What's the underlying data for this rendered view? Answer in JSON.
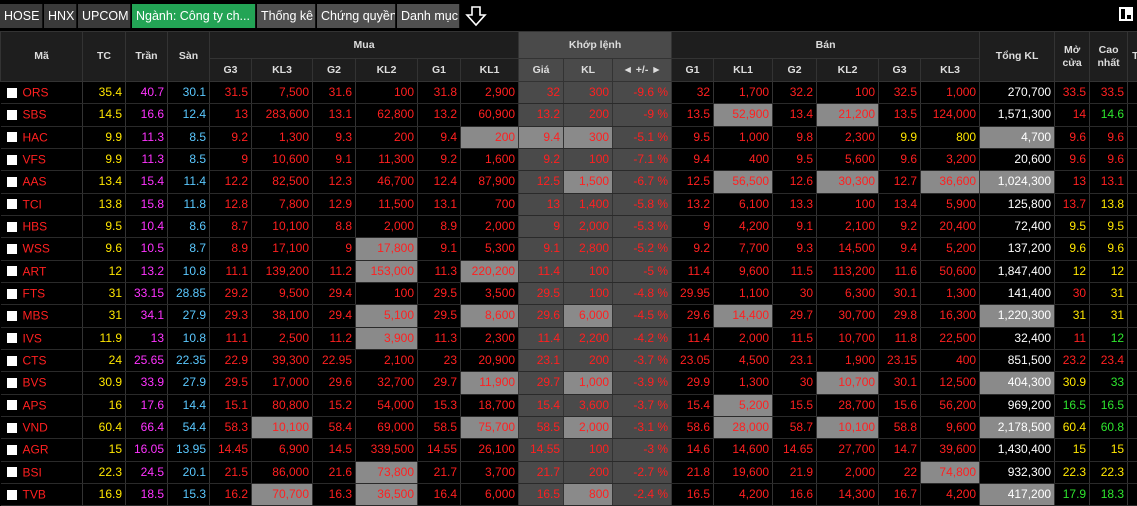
{
  "tabs": [
    {
      "label": "HOSE",
      "active": false
    },
    {
      "label": "HNX",
      "active": false
    },
    {
      "label": "UPCOM",
      "active": false
    },
    {
      "label": "Ngành: Công ty ch...",
      "active": true
    },
    {
      "label": "Thống kê",
      "active": false
    },
    {
      "label": "Chứng quyền",
      "active": false
    },
    {
      "label": "Danh mục",
      "active": false
    }
  ],
  "colors": {
    "up": "#ff2020",
    "ref": "#ffe600",
    "ceil": "#ff33ff",
    "floor": "#5ac8ff",
    "down": "#2ee52e",
    "active_tab": "#23a455"
  },
  "header": {
    "ma": "Mã",
    "tc": "TC",
    "tran": "Trần",
    "san": "Sàn",
    "mua": "Mua",
    "khop": "Khớp lệnh",
    "ban": "Bán",
    "tong_kl": "Tổng KL",
    "mo_cua": "Mở cửa",
    "cao_nhat": "Cao nhất",
    "thap_nhat": "Thấ",
    "mua_cols": [
      "G3",
      "KL3",
      "G2",
      "KL2",
      "G1",
      "KL1"
    ],
    "khop_cols": [
      "Giá",
      "KL",
      "◄ +/- ►"
    ],
    "ban_cols": [
      "G1",
      "KL1",
      "G2",
      "KL2",
      "G3",
      "KL3"
    ]
  },
  "rows": [
    {
      "cells": [
        "ORS",
        "35.4",
        "40.7",
        "30.1",
        "31.5",
        "7,500",
        "31.6",
        "100",
        "31.8",
        "2,900",
        "32",
        "300",
        "-9.6 %",
        "32",
        "1,700",
        "32.2",
        "100",
        "32.5",
        "1,000",
        "270,700",
        "33.5",
        "33.5",
        "33"
      ],
      "colors": [
        "r",
        "ref",
        "ceil",
        "floor",
        "r",
        "r",
        "r",
        "r",
        "r",
        "r",
        "r",
        "r",
        "r",
        "r",
        "r",
        "r",
        "r",
        "r",
        "r",
        "w",
        "r",
        "r",
        "r"
      ],
      "hl": []
    },
    {
      "cells": [
        "SBS",
        "14.5",
        "16.6",
        "12.4",
        "13",
        "283,600",
        "13.1",
        "62,800",
        "13.2",
        "60,900",
        "13.2",
        "200",
        "-9 %",
        "13.5",
        "52,900",
        "13.4",
        "21,200",
        "13.5",
        "124,000",
        "1,571,300",
        "14",
        "14.6",
        "13"
      ],
      "colors": [
        "r",
        "ref",
        "ceil",
        "floor",
        "r",
        "r",
        "r",
        "r",
        "r",
        "r",
        "r",
        "r",
        "r",
        "r",
        "r",
        "r",
        "r",
        "r",
        "r",
        "w",
        "r",
        "g",
        "r"
      ],
      "hl": [
        14,
        16
      ]
    },
    {
      "cells": [
        "HAC",
        "9.9",
        "11.3",
        "8.5",
        "9.2",
        "1,300",
        "9.3",
        "200",
        "9.4",
        "200",
        "9.4",
        "300",
        "-5.1 %",
        "9.5",
        "1,000",
        "9.8",
        "2,300",
        "9.9",
        "800",
        "4,700",
        "9.6",
        "9.6",
        "9"
      ],
      "colors": [
        "r",
        "ref",
        "ceil",
        "floor",
        "r",
        "r",
        "r",
        "r",
        "r",
        "r",
        "r",
        "r",
        "r",
        "r",
        "r",
        "r",
        "r",
        "y",
        "y",
        "w",
        "r",
        "r",
        "r"
      ],
      "hl": [
        9,
        10,
        11,
        19
      ]
    },
    {
      "cells": [
        "VFS",
        "9.9",
        "11.3",
        "8.5",
        "9",
        "10,600",
        "9.1",
        "11,300",
        "9.2",
        "1,600",
        "9.2",
        "100",
        "-7.1 %",
        "9.4",
        "400",
        "9.5",
        "5,600",
        "9.6",
        "3,200",
        "20,600",
        "9.6",
        "9.6",
        "9"
      ],
      "colors": [
        "r",
        "ref",
        "ceil",
        "floor",
        "r",
        "r",
        "r",
        "r",
        "r",
        "r",
        "r",
        "r",
        "r",
        "r",
        "r",
        "r",
        "r",
        "r",
        "r",
        "w",
        "r",
        "r",
        "r"
      ],
      "hl": []
    },
    {
      "cells": [
        "AAS",
        "13.4",
        "15.4",
        "11.4",
        "12.2",
        "82,500",
        "12.3",
        "46,700",
        "12.4",
        "87,900",
        "12.5",
        "1,500",
        "-6.7 %",
        "12.5",
        "56,500",
        "12.6",
        "30,300",
        "12.7",
        "36,600",
        "1,024,300",
        "13",
        "13.1",
        "12"
      ],
      "colors": [
        "r",
        "ref",
        "ceil",
        "floor",
        "r",
        "r",
        "r",
        "r",
        "r",
        "r",
        "r",
        "r",
        "r",
        "r",
        "r",
        "r",
        "r",
        "r",
        "r",
        "w",
        "r",
        "r",
        "r"
      ],
      "hl": [
        11,
        14,
        16,
        18,
        19
      ]
    },
    {
      "cells": [
        "TCI",
        "13.8",
        "15.8",
        "11.8",
        "12.8",
        "7,800",
        "12.9",
        "11,500",
        "13.1",
        "700",
        "13",
        "1,400",
        "-5.8 %",
        "13.2",
        "6,100",
        "13.3",
        "100",
        "13.4",
        "5,900",
        "125,800",
        "13.7",
        "13.8",
        "12"
      ],
      "colors": [
        "r",
        "ref",
        "ceil",
        "floor",
        "r",
        "r",
        "r",
        "r",
        "r",
        "r",
        "r",
        "r",
        "r",
        "r",
        "r",
        "r",
        "r",
        "r",
        "r",
        "w",
        "r",
        "y",
        "r"
      ],
      "hl": []
    },
    {
      "cells": [
        "HBS",
        "9.5",
        "10.4",
        "8.6",
        "8.7",
        "10,100",
        "8.8",
        "2,000",
        "8.9",
        "2,000",
        "9",
        "2,000",
        "-5.3 %",
        "9",
        "4,200",
        "9.1",
        "2,100",
        "9.2",
        "20,400",
        "72,400",
        "9.5",
        "9.5",
        "8"
      ],
      "colors": [
        "r",
        "ref",
        "ceil",
        "floor",
        "r",
        "r",
        "r",
        "r",
        "r",
        "r",
        "r",
        "r",
        "r",
        "r",
        "r",
        "r",
        "r",
        "r",
        "r",
        "w",
        "y",
        "y",
        "r"
      ],
      "hl": []
    },
    {
      "cells": [
        "WSS",
        "9.6",
        "10.5",
        "8.7",
        "8.9",
        "17,100",
        "9",
        "17,800",
        "9.1",
        "5,300",
        "9.1",
        "2,800",
        "-5.2 %",
        "9.2",
        "7,700",
        "9.3",
        "14,500",
        "9.4",
        "5,200",
        "137,200",
        "9.6",
        "9.6",
        "9"
      ],
      "colors": [
        "r",
        "ref",
        "ceil",
        "floor",
        "r",
        "r",
        "r",
        "r",
        "r",
        "r",
        "r",
        "r",
        "r",
        "r",
        "r",
        "r",
        "r",
        "r",
        "r",
        "w",
        "y",
        "y",
        "r"
      ],
      "hl": [
        7
      ]
    },
    {
      "cells": [
        "ART",
        "12",
        "13.2",
        "10.8",
        "11.1",
        "139,200",
        "11.2",
        "153,000",
        "11.3",
        "220,200",
        "11.4",
        "100",
        "-5 %",
        "11.4",
        "9,600",
        "11.5",
        "113,200",
        "11.6",
        "50,600",
        "1,847,400",
        "12",
        "12",
        "11"
      ],
      "colors": [
        "r",
        "ref",
        "ceil",
        "floor",
        "r",
        "r",
        "r",
        "r",
        "r",
        "r",
        "r",
        "r",
        "r",
        "r",
        "r",
        "r",
        "r",
        "r",
        "r",
        "w",
        "y",
        "y",
        "r"
      ],
      "hl": [
        7,
        9
      ]
    },
    {
      "cells": [
        "FTS",
        "31",
        "33.15",
        "28.85",
        "29.2",
        "9,500",
        "29.4",
        "100",
        "29.5",
        "3,500",
        "29.5",
        "100",
        "-4.8 %",
        "29.95",
        "1,100",
        "30",
        "6,300",
        "30.1",
        "1,300",
        "141,400",
        "30",
        "31",
        "29"
      ],
      "colors": [
        "r",
        "ref",
        "ceil",
        "floor",
        "r",
        "r",
        "r",
        "r",
        "r",
        "r",
        "r",
        "r",
        "r",
        "r",
        "r",
        "r",
        "r",
        "r",
        "r",
        "w",
        "r",
        "y",
        "r"
      ],
      "hl": []
    },
    {
      "cells": [
        "MBS",
        "31",
        "34.1",
        "27.9",
        "29.3",
        "38,100",
        "29.4",
        "5,100",
        "29.5",
        "8,600",
        "29.6",
        "6,000",
        "-4.5 %",
        "29.6",
        "14,400",
        "29.7",
        "30,700",
        "29.8",
        "16,300",
        "1,220,300",
        "31",
        "31",
        "27"
      ],
      "colors": [
        "r",
        "ref",
        "ceil",
        "floor",
        "r",
        "r",
        "r",
        "r",
        "r",
        "r",
        "r",
        "r",
        "r",
        "r",
        "r",
        "r",
        "r",
        "r",
        "r",
        "w",
        "y",
        "y",
        "b"
      ],
      "hl": [
        7,
        9,
        11,
        14,
        19
      ]
    },
    {
      "cells": [
        "IVS",
        "11.9",
        "13",
        "10.8",
        "11.1",
        "2,500",
        "11.2",
        "3,900",
        "11.3",
        "2,300",
        "11.4",
        "2,200",
        "-4.2 %",
        "11.4",
        "2,000",
        "11.5",
        "10,700",
        "11.8",
        "22,500",
        "32,400",
        "11",
        "12",
        "11"
      ],
      "colors": [
        "r",
        "ref",
        "ceil",
        "floor",
        "r",
        "r",
        "r",
        "r",
        "r",
        "r",
        "r",
        "r",
        "r",
        "r",
        "r",
        "r",
        "r",
        "r",
        "r",
        "w",
        "r",
        "g",
        "r"
      ],
      "hl": [
        7
      ]
    },
    {
      "cells": [
        "CTS",
        "24",
        "25.65",
        "22.35",
        "22.9",
        "39,300",
        "22.95",
        "2,100",
        "23",
        "20,900",
        "23.1",
        "200",
        "-3.7 %",
        "23.05",
        "4,500",
        "23.1",
        "1,900",
        "23.15",
        "400",
        "851,500",
        "23.2",
        "23.4",
        "23"
      ],
      "colors": [
        "r",
        "ref",
        "ceil",
        "floor",
        "r",
        "r",
        "r",
        "r",
        "r",
        "r",
        "r",
        "r",
        "r",
        "r",
        "r",
        "r",
        "r",
        "r",
        "r",
        "w",
        "r",
        "r",
        "r"
      ],
      "hl": []
    },
    {
      "cells": [
        "BVS",
        "30.9",
        "33.9",
        "27.9",
        "29.5",
        "17,000",
        "29.6",
        "32,700",
        "29.7",
        "11,900",
        "29.7",
        "1,000",
        "-3.9 %",
        "29.9",
        "1,300",
        "30",
        "10,700",
        "30.1",
        "12,500",
        "404,300",
        "30.9",
        "33",
        "29"
      ],
      "colors": [
        "r",
        "ref",
        "ceil",
        "floor",
        "r",
        "r",
        "r",
        "r",
        "r",
        "r",
        "r",
        "r",
        "r",
        "r",
        "r",
        "r",
        "r",
        "r",
        "r",
        "w",
        "y",
        "g",
        "r"
      ],
      "hl": [
        9,
        11,
        16,
        19
      ]
    },
    {
      "cells": [
        "APS",
        "16",
        "17.6",
        "14.4",
        "15.1",
        "80,800",
        "15.2",
        "54,000",
        "15.3",
        "18,700",
        "15.4",
        "3,600",
        "-3.7 %",
        "15.4",
        "5,200",
        "15.5",
        "28,700",
        "15.6",
        "56,200",
        "969,200",
        "16.5",
        "16.5",
        "15"
      ],
      "colors": [
        "r",
        "ref",
        "ceil",
        "floor",
        "r",
        "r",
        "r",
        "r",
        "r",
        "r",
        "r",
        "r",
        "r",
        "r",
        "r",
        "r",
        "r",
        "r",
        "r",
        "w",
        "g",
        "g",
        "r"
      ],
      "hl": [
        14
      ]
    },
    {
      "cells": [
        "VND",
        "60.4",
        "66.4",
        "54.4",
        "58.3",
        "10,100",
        "58.4",
        "69,000",
        "58.5",
        "75,700",
        "58.5",
        "2,000",
        "-3.1 %",
        "58.6",
        "28,000",
        "58.7",
        "10,100",
        "58.8",
        "9,600",
        "2,178,500",
        "60.4",
        "60.8",
        "58"
      ],
      "colors": [
        "r",
        "ref",
        "ceil",
        "floor",
        "r",
        "r",
        "r",
        "r",
        "r",
        "r",
        "r",
        "r",
        "r",
        "r",
        "r",
        "r",
        "r",
        "r",
        "r",
        "w",
        "y",
        "g",
        "r"
      ],
      "hl": [
        5,
        9,
        11,
        14,
        16,
        19
      ]
    },
    {
      "cells": [
        "AGR",
        "15",
        "16.05",
        "13.95",
        "14.45",
        "6,900",
        "14.5",
        "339,500",
        "14.55",
        "26,100",
        "14.55",
        "100",
        "-3 %",
        "14.6",
        "14,600",
        "14.65",
        "27,700",
        "14.7",
        "39,600",
        "1,430,400",
        "15",
        "15",
        "14"
      ],
      "colors": [
        "r",
        "ref",
        "ceil",
        "floor",
        "r",
        "r",
        "r",
        "r",
        "r",
        "r",
        "r",
        "r",
        "r",
        "r",
        "r",
        "r",
        "r",
        "r",
        "r",
        "w",
        "y",
        "y",
        "r"
      ],
      "hl": []
    },
    {
      "cells": [
        "BSI",
        "22.3",
        "24.5",
        "20.1",
        "21.5",
        "86,000",
        "21.6",
        "73,800",
        "21.7",
        "3,700",
        "21.7",
        "200",
        "-2.7 %",
        "21.8",
        "19,600",
        "21.9",
        "2,000",
        "22",
        "74,800",
        "932,300",
        "22.3",
        "22.3",
        "21"
      ],
      "colors": [
        "r",
        "ref",
        "ceil",
        "floor",
        "r",
        "r",
        "r",
        "r",
        "r",
        "r",
        "r",
        "r",
        "r",
        "r",
        "r",
        "r",
        "r",
        "r",
        "r",
        "w",
        "y",
        "y",
        "r"
      ],
      "hl": [
        7,
        18
      ]
    },
    {
      "cells": [
        "TVB",
        "16.9",
        "18.5",
        "15.3",
        "16.2",
        "70,700",
        "16.3",
        "36,500",
        "16.4",
        "6,000",
        "16.5",
        "800",
        "-2.4 %",
        "16.5",
        "4,200",
        "16.6",
        "14,300",
        "16.7",
        "4,200",
        "417,200",
        "17.9",
        "18.3",
        "16"
      ],
      "colors": [
        "r",
        "ref",
        "ceil",
        "floor",
        "r",
        "r",
        "r",
        "r",
        "r",
        "r",
        "r",
        "r",
        "r",
        "r",
        "r",
        "r",
        "r",
        "r",
        "r",
        "w",
        "g",
        "g",
        "r"
      ],
      "hl": [
        5,
        7,
        11,
        19
      ]
    }
  ]
}
